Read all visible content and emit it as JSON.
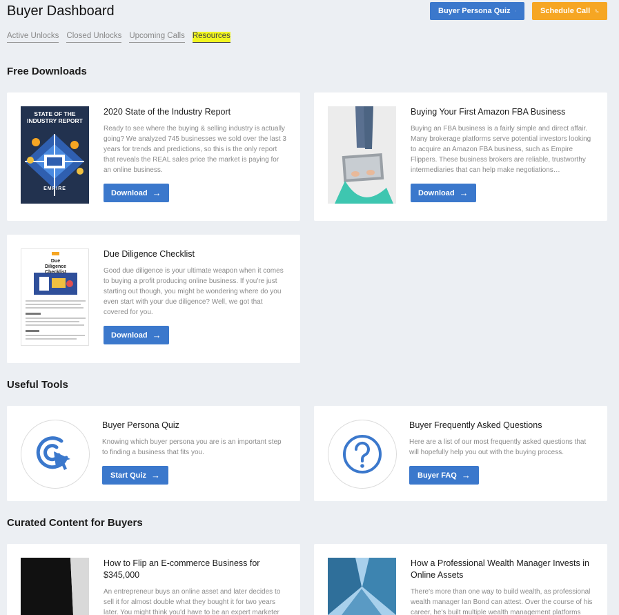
{
  "header": {
    "title": "Buyer Dashboard",
    "tabs": [
      "Active Unlocks",
      "Closed Unlocks",
      "Upcoming Calls",
      "Resources"
    ],
    "quiz_button": "Buyer Persona Quiz",
    "call_button": "Schedule Call"
  },
  "free_downloads": {
    "title": "Free Downloads",
    "items": [
      {
        "title": "2020 State of the Industry Report",
        "desc": "Ready to see where the buying & selling industry is actually going? We analyzed 745 businesses we sold over the last 3 years for trends and predictions, so this is the only report that reveals the REAL sales price the market is paying for an online business.",
        "button": "Download",
        "thumb_title": "STATE OF THE INDUSTRY REPORT",
        "thumb_brand": "EMPIRE"
      },
      {
        "title": "Buying Your First Amazon FBA Business",
        "desc": "Buying an FBA business is a fairly simple and direct affair. Many brokerage platforms serve potential investors looking to acquire an Amazon FBA business, such as Empire Flippers. These business brokers are reliable, trustworthy intermediaries that can help make negotiations…",
        "button": "Download"
      },
      {
        "title": "Due Diligence Checklist",
        "desc": "Good due diligence is your ultimate weapon when it comes to buying a profit producing online business. If you're just starting out though, you might be wondering where do you even start with your due diligence? Well, we got that covered for you.",
        "button": "Download",
        "thumb_title": "Due Diligence Checklist"
      }
    ]
  },
  "useful_tools": {
    "title": "Useful Tools",
    "items": [
      {
        "title": "Buyer Persona Quiz",
        "desc": "Knowing which buyer persona you are is an important step to finding a business that fits you.",
        "button": "Start Quiz",
        "icon": "target-cursor-icon"
      },
      {
        "title": "Buyer Frequently Asked Questions",
        "desc": "Here are a list of our most frequently asked questions that will hopefully help you out with the buying process.",
        "button": "Buyer FAQ",
        "icon": "question-circle-icon"
      }
    ]
  },
  "curated": {
    "title": "Curated Content for Buyers",
    "items": [
      {
        "title": "How to Flip an E-commerce Business for $345,000",
        "desc": "An entrepreneur buys an online asset and later decides to sell it for almost double what they bought it for two years later. You might think you'd have to be an expert marketer or superstar computer genius to grow a business this…"
      },
      {
        "title": "How a Professional Wealth Manager Invests in Online Assets",
        "desc": "There's more than one way to build wealth, as professional wealth manager Ian Bond can attest. Over the course of his career, he's built multiple wealth management platforms on…"
      }
    ]
  },
  "colors": {
    "accent_blue": "#3b78cc",
    "accent_orange": "#f6a623",
    "highlight": "#f0f520",
    "background": "#eceff3"
  }
}
